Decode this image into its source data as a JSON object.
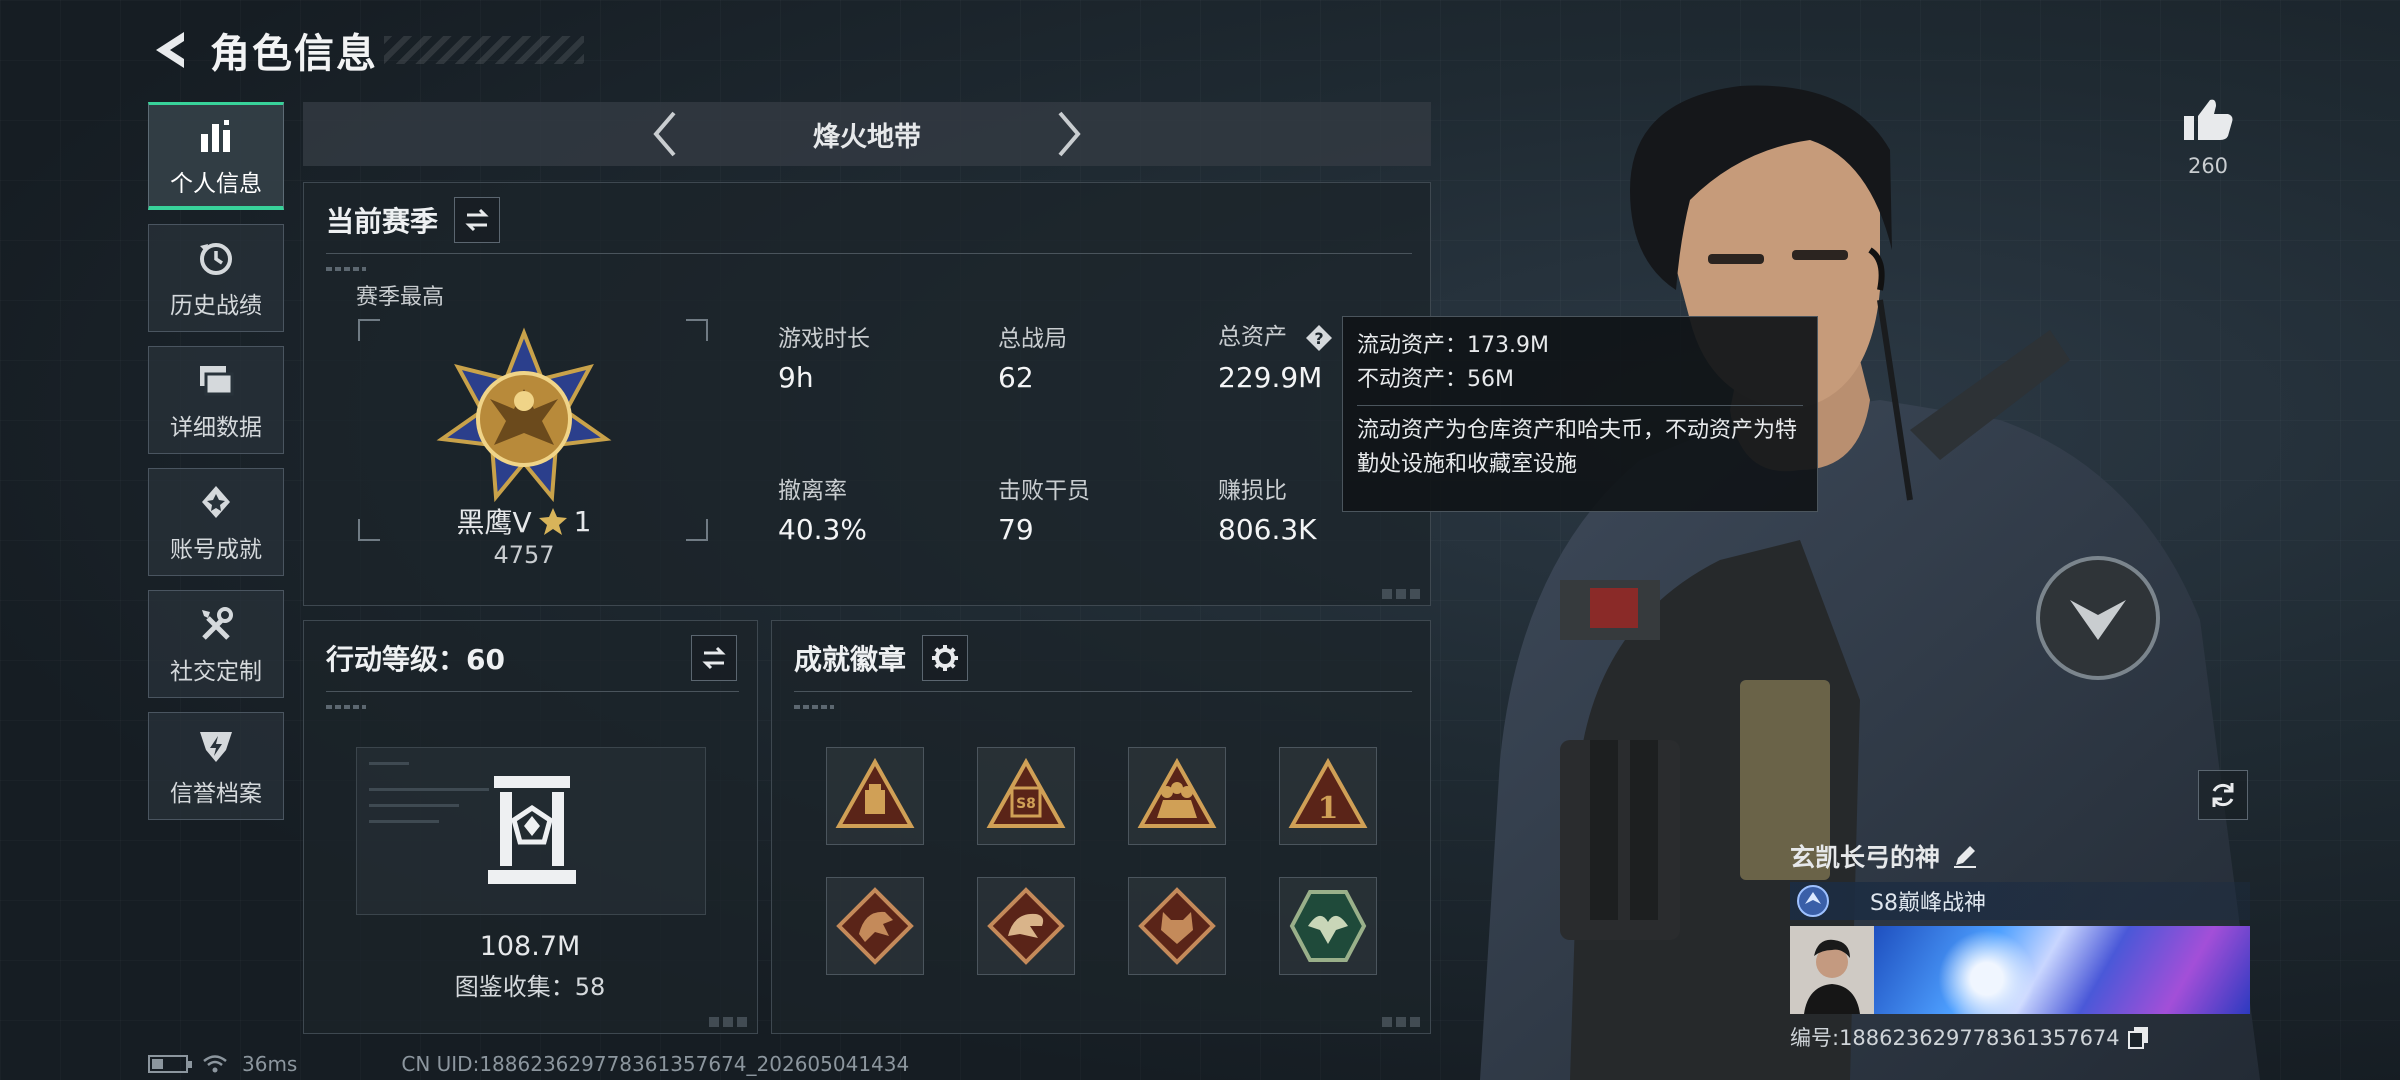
{
  "header": {
    "title": "角色信息"
  },
  "nav": {
    "items": [
      {
        "label": "个人信息",
        "icon": "bar-chart-icon",
        "active": true
      },
      {
        "label": "历史战绩",
        "icon": "history-icon",
        "active": false
      },
      {
        "label": "详细数据",
        "icon": "folders-icon",
        "active": false
      },
      {
        "label": "账号成就",
        "icon": "achievement-icon",
        "active": false
      },
      {
        "label": "社交定制",
        "icon": "tools-icon",
        "active": false
      },
      {
        "label": "信誉档案",
        "icon": "credit-icon",
        "active": false
      }
    ]
  },
  "mode": {
    "title": "烽火地带"
  },
  "season": {
    "title": "当前赛季",
    "best_label": "赛季最高",
    "rank_name": "黑鹰Ⅴ",
    "rank_stars": "1",
    "rank_score": "4757",
    "stats": [
      {
        "label": "游戏时长",
        "value": "9h"
      },
      {
        "label": "总战局",
        "value": "62"
      },
      {
        "label": "总资产",
        "value": "229.9M"
      },
      {
        "label": "撤离率",
        "value": "40.3%"
      },
      {
        "label": "击败干员",
        "value": "79"
      },
      {
        "label": "赚损比",
        "value": "806.3K"
      }
    ]
  },
  "tooltip": {
    "line1": "流动资产：173.9M",
    "line2": "不动资产：56M",
    "desc": "流动资产为仓库资产和哈夫币，不动资产为特勤处设施和收藏室设施"
  },
  "level": {
    "title": "行动等级：60",
    "value": "108.7M",
    "codex": "图鉴收集：58"
  },
  "badges": {
    "title": "成就徽章",
    "items": [
      "supply-badge-icon",
      "s8-badge-icon",
      "squad-badge-icon",
      "rank-one-badge-icon",
      "dragon-badge-icon",
      "serpent-badge-icon",
      "wolf-badge-icon",
      "eagle-badge-icon"
    ]
  },
  "profile": {
    "like_count": "260",
    "player_name": "玄凯长弓的神",
    "title": "S8巅峰战神",
    "id_line": "编号:1886236297783613576​74"
  },
  "status": {
    "ping": "36ms",
    "uid": "CN UID:188623629778361357674_202605041434",
    "battery_level": 0.35
  },
  "colors": {
    "accent": "#38d29a",
    "panel_border": "#3e4850",
    "background": "#1b242b"
  }
}
